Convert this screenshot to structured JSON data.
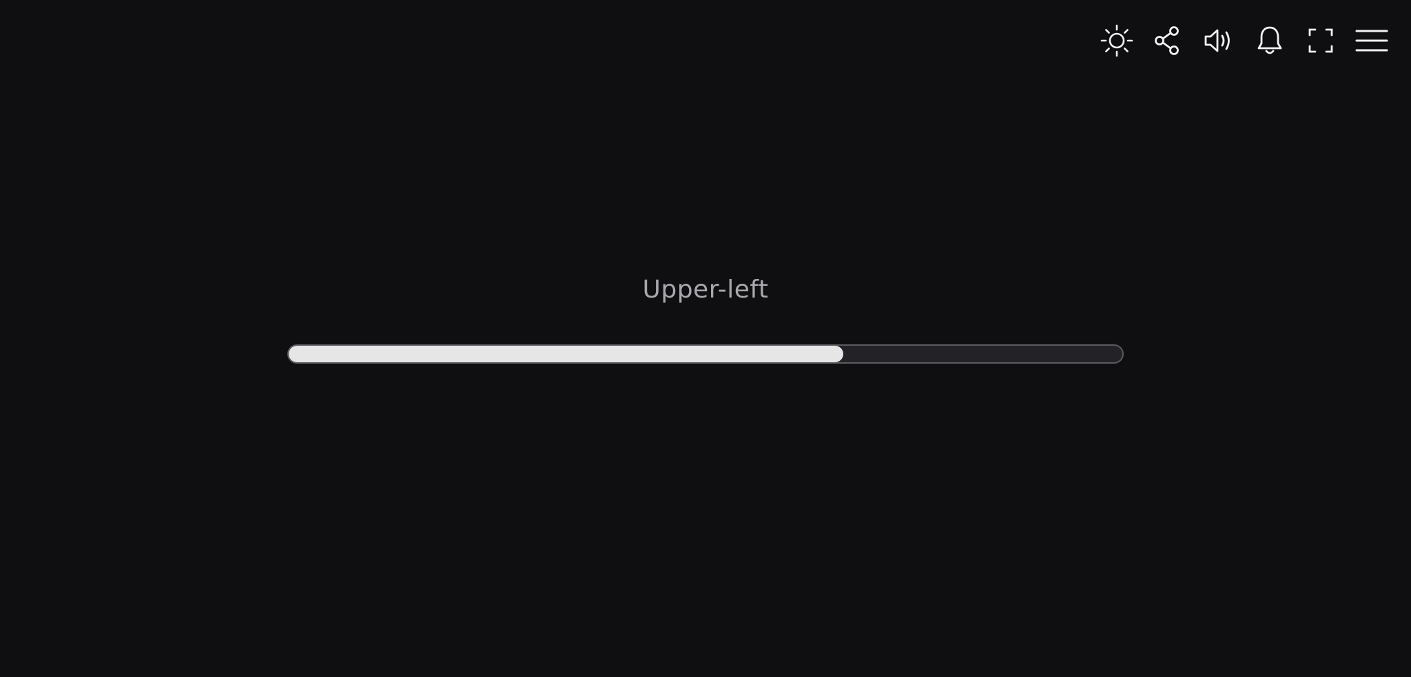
{
  "toolbar": {
    "icons": [
      "sun-icon",
      "share-icon",
      "volume-icon",
      "bell-icon",
      "fullscreen-icon",
      "menu-icon"
    ]
  },
  "main": {
    "label": "Upper-left",
    "progress": 0.665
  },
  "colors": {
    "background": "#0f0f11",
    "icon": "#f2f2f2",
    "label": "#a9a9ad",
    "track": "#222227",
    "track_border": "#5b5b60",
    "fill": "#e6e6e6"
  }
}
